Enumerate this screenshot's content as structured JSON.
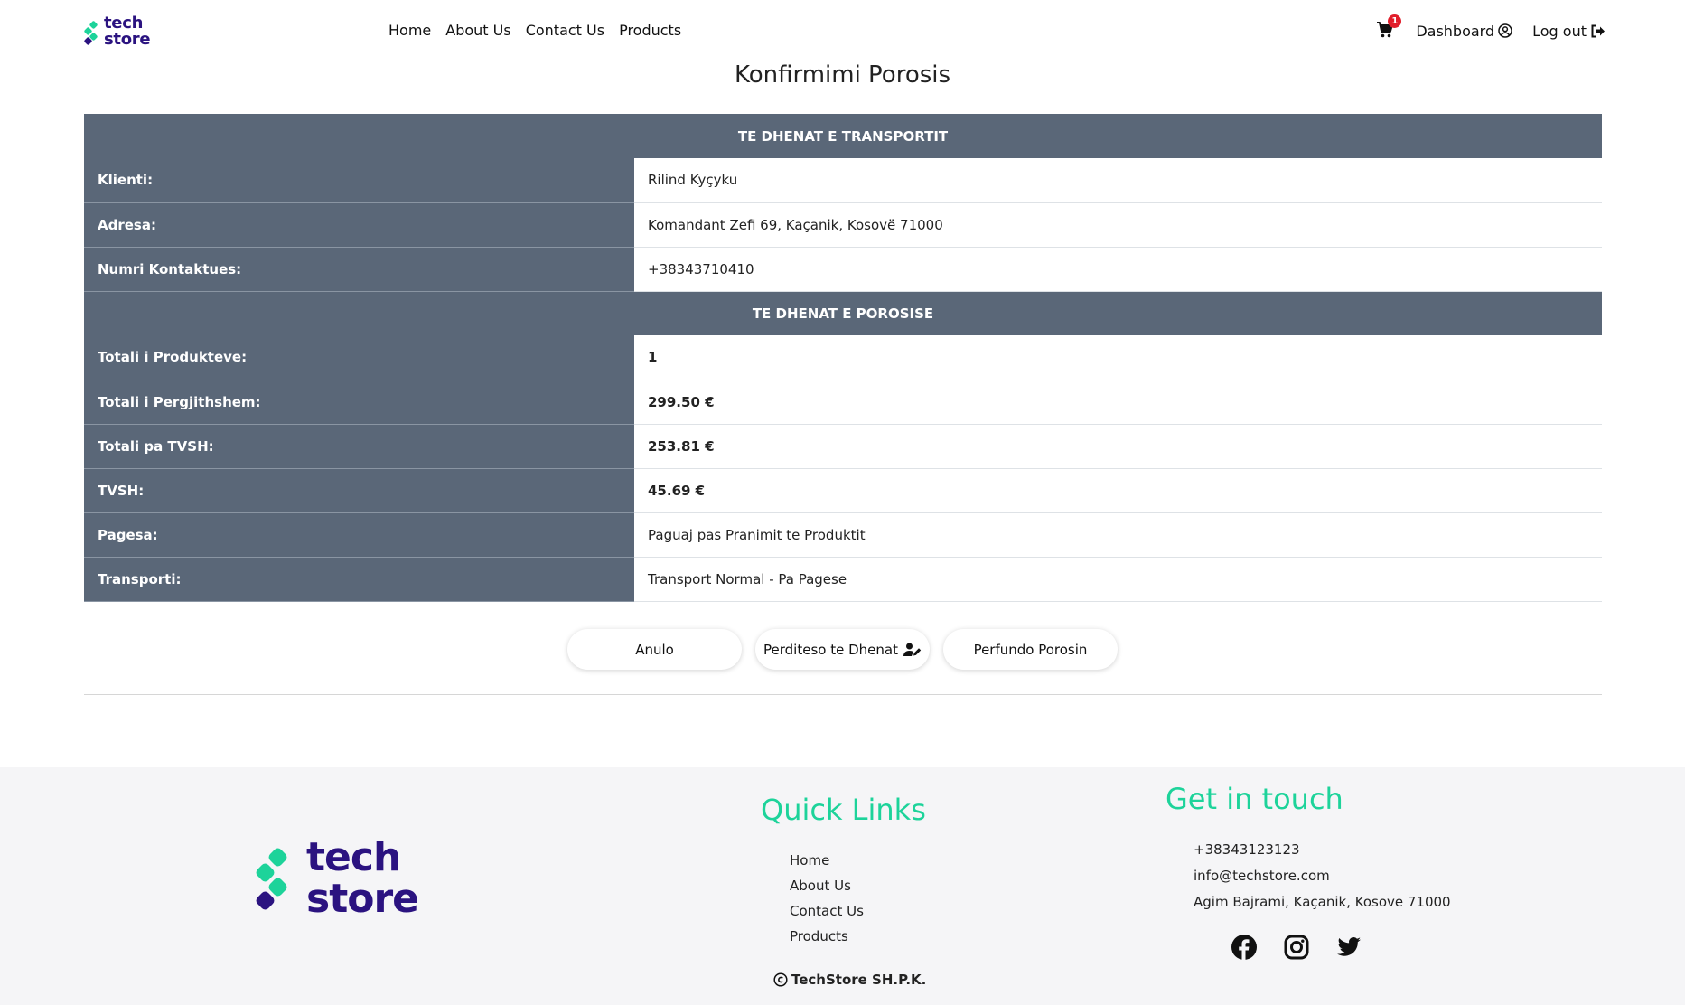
{
  "brand": {
    "name_line1": "tech",
    "name_line2": "store",
    "color": "#2b1380",
    "accent": "#1dd39a"
  },
  "nav": {
    "links": [
      "Home",
      "About Us",
      "Contact Us",
      "Products"
    ],
    "cart_count": "1",
    "dashboard_label": "Dashboard",
    "logout_label": "Log out"
  },
  "page": {
    "title": "Konfirmimi Porosis"
  },
  "order": {
    "transport_header": "TE DHENAT E TRANSPORTIT",
    "transport_rows": [
      {
        "label": "Klienti:",
        "value": "Rilind Kyçyku"
      },
      {
        "label": "Adresa:",
        "value": "Komandant Zefi 69, Kaçanik, Kosovë 71000"
      },
      {
        "label": "Numri Kontaktues:",
        "value": "+38343710410"
      }
    ],
    "order_header": "TE DHENAT E POROSISE",
    "order_rows": [
      {
        "label": "Totali i Produkteve:",
        "value": "1"
      },
      {
        "label": "Totali i Pergjithshem:",
        "value": "299.50 €"
      },
      {
        "label": "Totali pa TVSH:",
        "value": "253.81 €"
      },
      {
        "label": "TVSH:",
        "value": "45.69 €"
      },
      {
        "label": "Pagesa:",
        "value": "Paguaj pas Pranimit te Produktit"
      },
      {
        "label": "Transporti:",
        "value": "Transport Normal - Pa Pagese"
      }
    ]
  },
  "actions": {
    "cancel": "Anulo",
    "update": "Perditeso te Dhenat",
    "finish": "Perfundo Porosin"
  },
  "footer": {
    "quick_links_title": "Quick Links",
    "quick_links": [
      "Home",
      "About Us",
      "Contact Us",
      "Products"
    ],
    "contact_title": "Get in touch",
    "phone": "+38343123123",
    "email": "info@techstore.com",
    "address": "Agim Bajrami, Kaçanik, Kosove 71000",
    "socials": [
      "facebook-icon",
      "instagram-icon",
      "twitter-icon"
    ],
    "copyright": "TechStore SH.P.K."
  },
  "colors": {
    "table_header": "#5a6778",
    "badge": "#e11d2a"
  }
}
